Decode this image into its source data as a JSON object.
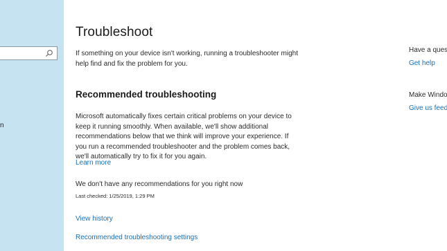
{
  "sidebar": {
    "search_placeholder": "",
    "item_fragment": "n"
  },
  "main": {
    "title": "Troubleshoot",
    "intro": "If something on your device isn't working, running a troubleshooter might help find and fix the problem for you.",
    "recommended": {
      "heading": "Recommended troubleshooting",
      "description": "Microsoft automatically fixes certain critical problems on your device to keep it running smoothly. When available, we'll show additional recommendations below that we think will improve your experience. If you run a recommended troubleshooter and the problem comes back, we'll automatically try to fix it for you again.",
      "learn_more": "Learn more",
      "no_recommendations": "We don't have any recommendations for you right now",
      "last_checked": "Last checked: 1/25/2019, 1:29 PM",
      "view_history": "View history",
      "settings_link": "Recommended troubleshooting settings"
    }
  },
  "right_panel": {
    "question_heading": "Have a ques",
    "get_help": "Get help",
    "make_windows_heading": "Make Windo",
    "feedback": "Give us feed"
  },
  "colors": {
    "sidebar_bg": "#c5e3f1",
    "link": "#1a6fb0"
  }
}
